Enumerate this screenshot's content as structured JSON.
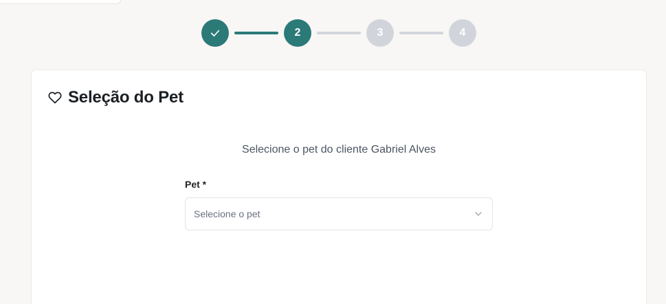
{
  "stepper": {
    "steps": [
      {
        "label": "",
        "state": "done",
        "icon": "check-icon"
      },
      {
        "label": "2",
        "state": "active"
      },
      {
        "label": "3",
        "state": "pending"
      },
      {
        "label": "4",
        "state": "pending"
      }
    ],
    "colors": {
      "active": "#2b7a78",
      "pending": "#d1d5db"
    }
  },
  "card": {
    "title": "Seleção do Pet",
    "title_icon": "heart-icon",
    "subtitle": "Selecione o pet do cliente Gabriel Alves",
    "pet_field": {
      "label": "Pet *",
      "placeholder": "Selecione o pet",
      "icon": "chevron-down-icon"
    }
  }
}
